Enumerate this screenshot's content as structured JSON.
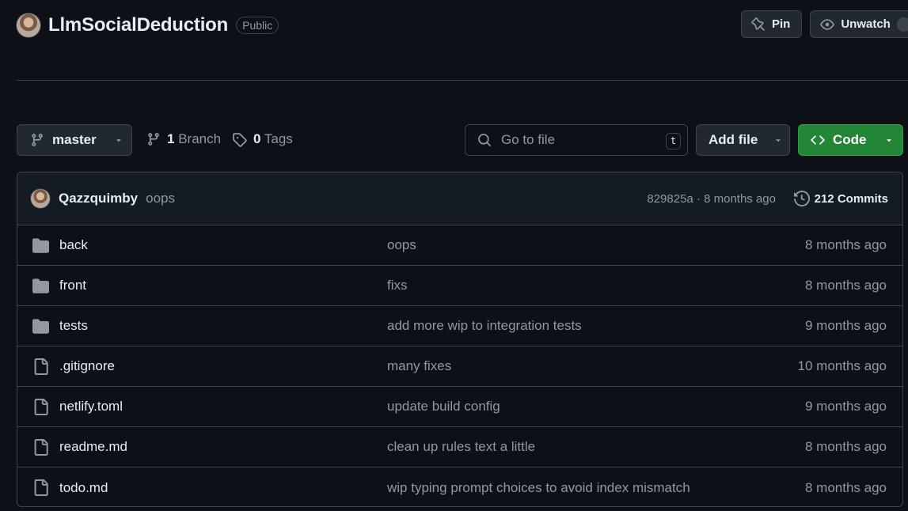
{
  "repo": {
    "name": "LlmSocialDeduction",
    "visibility": "Public"
  },
  "header_actions": {
    "pin_label": "Pin",
    "unwatch_label": "Unwatch"
  },
  "toolbar": {
    "branch": "master",
    "branches_count": "1",
    "branches_label": "Branch",
    "tags_count": "0",
    "tags_label": "Tags",
    "search_placeholder": "Go to file",
    "search_shortcut": "t",
    "add_file_label": "Add file",
    "code_label": "Code",
    "accent_color": "#238636"
  },
  "latest_commit": {
    "author": "Qazzquimby",
    "message": "oops",
    "meta": "829825a · 8 months ago",
    "commits_label": "212 Commits"
  },
  "files": [
    {
      "type": "folder",
      "name": "back",
      "message": "oops",
      "date": "8 months ago"
    },
    {
      "type": "folder",
      "name": "front",
      "message": "fixs",
      "date": "8 months ago"
    },
    {
      "type": "folder",
      "name": "tests",
      "message": "add more wip to integration tests",
      "date": "9 months ago"
    },
    {
      "type": "file",
      "name": ".gitignore",
      "message": "many fixes",
      "date": "10 months ago"
    },
    {
      "type": "file",
      "name": "netlify.toml",
      "message": "update build config",
      "date": "9 months ago"
    },
    {
      "type": "file",
      "name": "readme.md",
      "message": "clean up rules text a little",
      "date": "8 months ago"
    },
    {
      "type": "file",
      "name": "todo.md",
      "message": "wip typing prompt choices to avoid index mismatch",
      "date": "8 months ago"
    }
  ]
}
